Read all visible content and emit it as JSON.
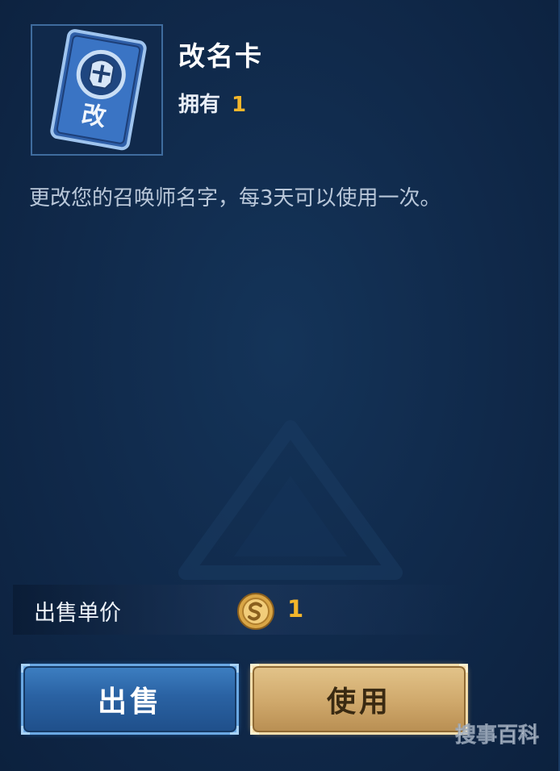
{
  "item": {
    "name": "改名卡",
    "card_glyph": "改",
    "owned_label": "拥有",
    "owned_count": "1",
    "description": "更改您的召唤师名字，每3天可以使用一次。",
    "icon": "helmet-card-icon"
  },
  "sell": {
    "price_label": "出售单价",
    "currency_icon": "silver-coin-icon",
    "price": "1"
  },
  "actions": {
    "sell_label": "出售",
    "use_label": "使用"
  },
  "watermark": {
    "text": "搜事百科",
    "icon": "watermark-logo"
  },
  "colors": {
    "background": "#10294a",
    "accent_gold": "#f3b62b",
    "sell_button": "#2a62a3",
    "use_button": "#cfa86b"
  }
}
